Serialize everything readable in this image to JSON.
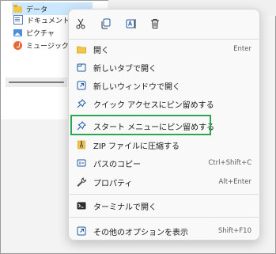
{
  "explorer": {
    "nav_items": [
      {
        "label": "データ",
        "icon": "folder-icon"
      },
      {
        "label": "ドキュメント",
        "icon": "documents-icon"
      },
      {
        "label": "ピクチャ",
        "icon": "pictures-icon"
      },
      {
        "label": "ミュージック",
        "icon": "music-icon"
      }
    ]
  },
  "context_menu": {
    "toolbar": [
      {
        "name": "cut",
        "icon": "scissors-icon"
      },
      {
        "name": "copy",
        "icon": "copy-icon"
      },
      {
        "name": "rename",
        "icon": "rename-icon"
      },
      {
        "name": "delete",
        "icon": "trash-icon"
      }
    ],
    "items": [
      {
        "label": "開く",
        "shortcut": "Enter",
        "icon": "folder-open-icon"
      },
      {
        "label": "新しいタブで開く",
        "shortcut": "",
        "icon": "new-tab-icon"
      },
      {
        "label": "新しいウィンドウで開く",
        "shortcut": "",
        "icon": "new-window-icon"
      },
      {
        "label": "クイック アクセスにピン留めする",
        "shortcut": "",
        "icon": "pin-icon"
      },
      {
        "label": "スタート メニューにピン留めする",
        "shortcut": "",
        "icon": "pin-icon"
      },
      {
        "label": "ZIP ファイルに圧縮する",
        "shortcut": "",
        "icon": "zip-icon"
      },
      {
        "label": "パスのコピー",
        "shortcut": "Ctrl+Shift+C",
        "icon": "copy-path-icon"
      },
      {
        "label": "プロパティ",
        "shortcut": "Alt+Enter",
        "icon": "wrench-icon"
      },
      {
        "label": "ターミナルで開く",
        "shortcut": "",
        "icon": "terminal-icon"
      },
      {
        "label": "その他のオプションを表示",
        "shortcut": "Shift+F10",
        "icon": "more-options-icon"
      }
    ]
  },
  "colors": {
    "highlight_box": "#2aa84f",
    "accent": "#1f5aa6",
    "selection": "#cce8ff"
  }
}
